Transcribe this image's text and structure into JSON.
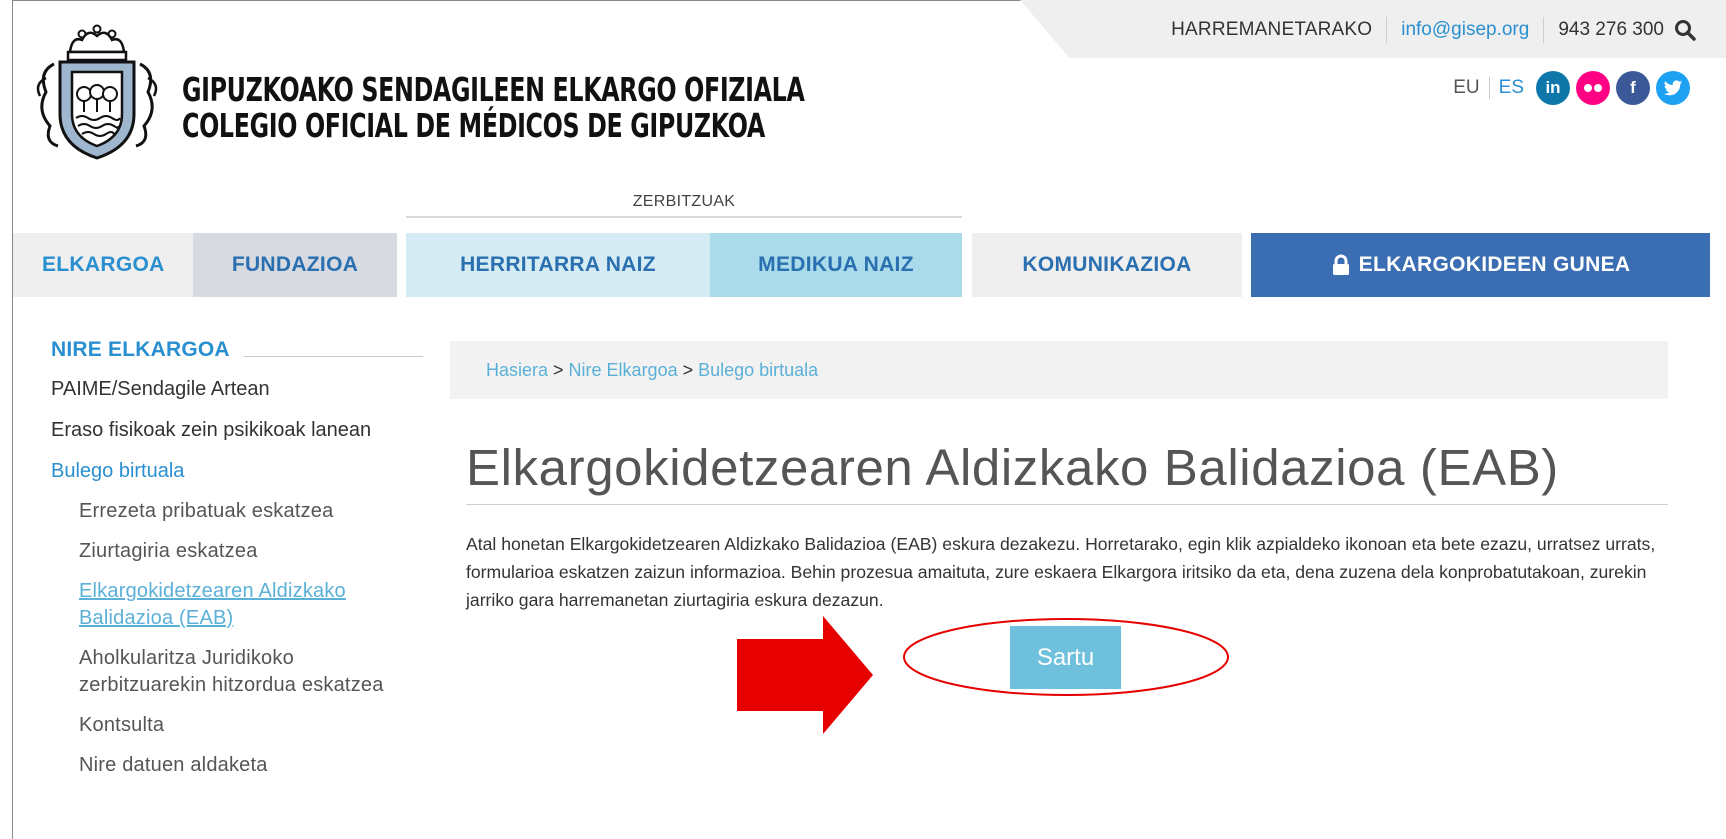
{
  "topbar": {
    "contact_label": "HARREMANETARAKO",
    "email": "info@gisep.org",
    "phone": "943 276 300"
  },
  "brand": {
    "line1": "GIPUZKOAKO SENDAGILEEN ELKARGO OFIZIALA",
    "line2": "COLEGIO OFICIAL DE MÉDICOS DE GIPUZKOA"
  },
  "languages": {
    "eu": "EU",
    "es": "ES"
  },
  "social": [
    {
      "name": "linkedin-icon",
      "glyph": "in",
      "color": "#0e76a8"
    },
    {
      "name": "flickr-icon",
      "glyph": "••",
      "color": "#ff0084"
    },
    {
      "name": "facebook-icon",
      "glyph": "f",
      "color": "#3b5998"
    },
    {
      "name": "twitter-icon",
      "glyph": "t",
      "color": "#1da1f2"
    }
  ],
  "services_label": "ZERBITZUAK",
  "nav": {
    "elkargoa": "ELKARGOA",
    "fundazioa": "FUNDAZIOA",
    "herritarra": "HERRITARRA NAIZ",
    "medikua": "MEDIKUA NAIZ",
    "komunikazioa": "KOMUNIKAZIOA",
    "gunea": "ELKARGOKIDEEN GUNEA"
  },
  "sidebar": {
    "title": "NIRE ELKARGOA",
    "items": [
      "PAIME/Sendagile Artean",
      "Eraso fisikoak zein psikikoak lanean",
      "Bulego birtuala"
    ],
    "subitems": [
      "Errezeta pribatuak eskatzea",
      "Ziurtagiria eskatzea",
      "Elkargokidetzearen Aldizkako Balidazioa (EAB)",
      "Aholkularitza Juridikoko zerbitzuarekin hitzordua eskatzea",
      "Kontsulta",
      "Nire datuen aldaketa"
    ]
  },
  "breadcrumb": {
    "home": "Hasiera",
    "section": "Nire Elkargoa",
    "current": "Bulego birtuala",
    "separator": ">"
  },
  "main": {
    "title": "Elkargokidetzearen Aldizkako Balidazioa (EAB)",
    "body": "Atal honetan Elkargokidetzearen Aldizkako Balidazioa (EAB) eskura dezakezu. Horretarako, egin klik azpialdeko ikonoan eta bete ezazu, urratsez urrats, formularioa eskatzen zaizun informazioa. Behin prozesua amaituta, zure eskaera Elkargora iritsiko da eta, dena zuzena dela konprobatutakoan, zurekin jarriko gara harremanetan ziurtagiria eskura dezazun.",
    "button": "Sartu"
  },
  "colors": {
    "accent": "#2a8fd0",
    "nav_dark": "#3a6db2",
    "button": "#6fc0dc",
    "annotation": "#e60000"
  }
}
